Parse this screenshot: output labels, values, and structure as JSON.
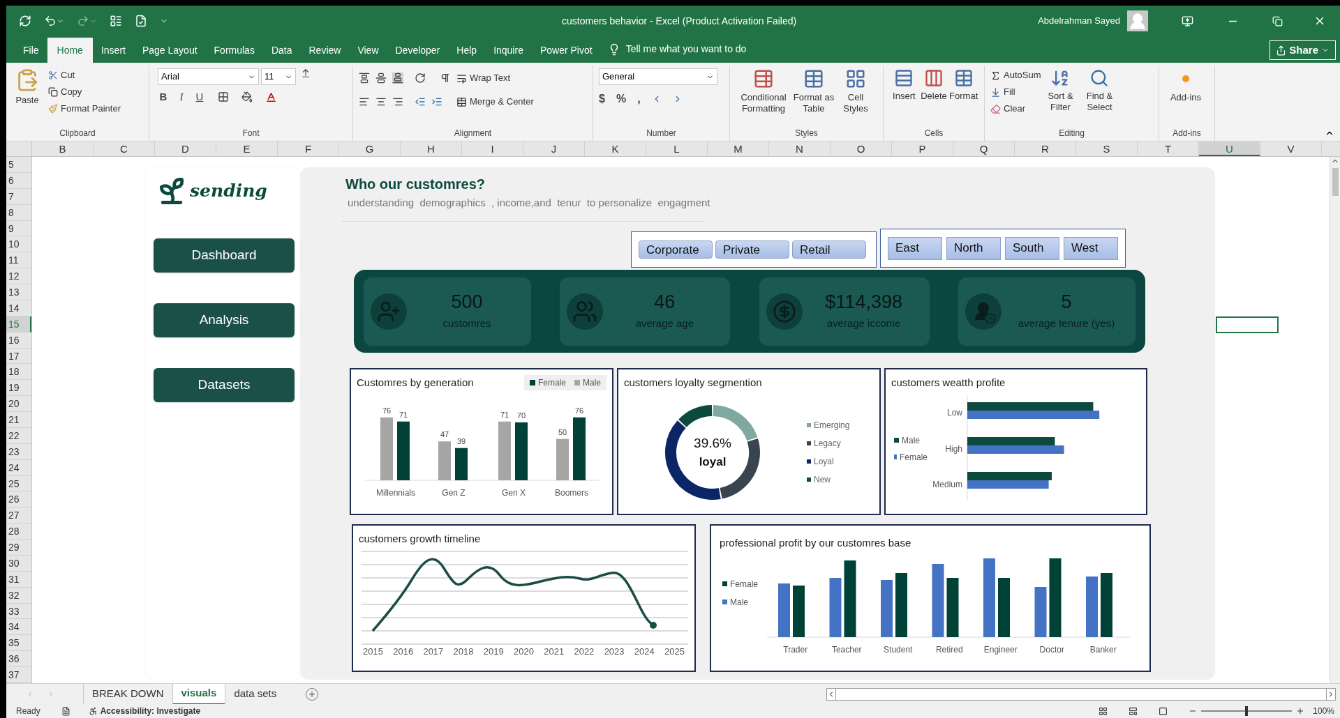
{
  "title_bar": {
    "title": "customers behavior  -  Excel (Product Activation Failed)",
    "user": "Abdelrahman Sayed"
  },
  "ribbon_tabs": [
    {
      "label": "File",
      "selected": false
    },
    {
      "label": "Home",
      "selected": true
    },
    {
      "label": "Insert",
      "selected": false
    },
    {
      "label": "Page Layout",
      "selected": false
    },
    {
      "label": "Formulas",
      "selected": false
    },
    {
      "label": "Data",
      "selected": false
    },
    {
      "label": "Review",
      "selected": false
    },
    {
      "label": "View",
      "selected": false
    },
    {
      "label": "Developer",
      "selected": false
    },
    {
      "label": "Help",
      "selected": false
    },
    {
      "label": "Inquire",
      "selected": false
    },
    {
      "label": "Power Pivot",
      "selected": false
    }
  ],
  "tell_me": "Tell me what you want to do",
  "share": "Share",
  "ribbon": {
    "clipboard": {
      "paste": "Paste",
      "cut": "Cut",
      "copy": "Copy",
      "format_painter": "Format Painter",
      "label": "Clipboard"
    },
    "font": {
      "family": "Arial",
      "size": "11",
      "styles": [
        "B",
        "I",
        "U"
      ],
      "label": "Font"
    },
    "alignment": {
      "wrap": "Wrap Text",
      "merge": "Merge & Center",
      "label": "Alignment"
    },
    "number": {
      "format": "General",
      "symbols": [
        "$",
        "%",
        ","
      ],
      "label": "Number"
    },
    "styles": {
      "items": [
        "Conditional Formatting",
        "Format as Table",
        "Cell Styles"
      ],
      "label": "Styles"
    },
    "cells": {
      "items": [
        "Insert",
        "Delete",
        "Format"
      ],
      "label": "Cells"
    },
    "editing": {
      "autosum": "AutoSum",
      "fill": "Fill",
      "clear": "Clear",
      "sort": "Sort & Filter",
      "find": "Find & Select",
      "label": "Editing"
    },
    "addins": {
      "button": "Add-ins",
      "label": "Add-ins"
    }
  },
  "columns": [
    {
      "label": "B",
      "selected": false
    },
    {
      "label": "C",
      "selected": false
    },
    {
      "label": "D",
      "selected": false
    },
    {
      "label": "E",
      "selected": false
    },
    {
      "label": "F",
      "selected": false
    },
    {
      "label": "G",
      "selected": false
    },
    {
      "label": "H",
      "selected": false
    },
    {
      "label": "I",
      "selected": false
    },
    {
      "label": "J",
      "selected": false
    },
    {
      "label": "K",
      "selected": false
    },
    {
      "label": "L",
      "selected": false
    },
    {
      "label": "M",
      "selected": false
    },
    {
      "label": "N",
      "selected": false
    },
    {
      "label": "O",
      "selected": false
    },
    {
      "label": "P",
      "selected": false
    },
    {
      "label": "Q",
      "selected": false
    },
    {
      "label": "R",
      "selected": false
    },
    {
      "label": "S",
      "selected": false
    },
    {
      "label": "T",
      "selected": false
    },
    {
      "label": "U",
      "selected": true
    },
    {
      "label": "V",
      "selected": false
    }
  ],
  "rows": [
    {
      "label": "5",
      "selected": false
    },
    {
      "label": "6",
      "selected": false
    },
    {
      "label": "7",
      "selected": false
    },
    {
      "label": "8",
      "selected": false
    },
    {
      "label": "9",
      "selected": false
    },
    {
      "label": "10",
      "selected": false
    },
    {
      "label": "11",
      "selected": false
    },
    {
      "label": "12",
      "selected": false
    },
    {
      "label": "13",
      "selected": false
    },
    {
      "label": "14",
      "selected": false
    },
    {
      "label": "15",
      "selected": true
    },
    {
      "label": "16",
      "selected": false
    },
    {
      "label": "17",
      "selected": false
    },
    {
      "label": "18",
      "selected": false
    },
    {
      "label": "19",
      "selected": false
    },
    {
      "label": "20",
      "selected": false
    },
    {
      "label": "21",
      "selected": false
    },
    {
      "label": "22",
      "selected": false
    },
    {
      "label": "23",
      "selected": false
    },
    {
      "label": "24",
      "selected": false
    },
    {
      "label": "25",
      "selected": false
    },
    {
      "label": "26",
      "selected": false
    },
    {
      "label": "27",
      "selected": false
    },
    {
      "label": "28",
      "selected": false
    },
    {
      "label": "29",
      "selected": false
    },
    {
      "label": "30",
      "selected": false
    },
    {
      "label": "31",
      "selected": false
    },
    {
      "label": "32",
      "selected": false
    },
    {
      "label": "33",
      "selected": false
    },
    {
      "label": "34",
      "selected": false
    },
    {
      "label": "35",
      "selected": false
    },
    {
      "label": "36",
      "selected": false
    },
    {
      "label": "37",
      "selected": false
    }
  ],
  "dashboard": {
    "logo": "sending",
    "nav": [
      "Dashboard",
      "Analysis",
      "Datasets"
    ],
    "title": "Who our customres?",
    "subtitle": "understanding  demographics  , income,and  tenur  to personalize  engagment",
    "segment_slicer": [
      "Corporate",
      "Private",
      "Retail"
    ],
    "region_slicer": [
      "East",
      "North",
      "South",
      "West"
    ],
    "kpis": [
      {
        "kind": "customers",
        "value": "500",
        "label": "customres"
      },
      {
        "kind": "age",
        "value": "46",
        "label": "average age"
      },
      {
        "kind": "income",
        "value": "$114,398",
        "label": "average iccome"
      },
      {
        "kind": "tenure",
        "value": "5",
        "label": "average tenure (yes)"
      }
    ],
    "generation": {
      "title": "Customres by generation",
      "chart_data": {
        "type": "bar",
        "categories": [
          "Millennials",
          "Gen Z",
          "Gen X",
          "Boomers"
        ],
        "data_labels": true,
        "series": [
          {
            "name": "Male",
            "color": "#a6a6a6",
            "values": [
              76,
              47,
              71,
              50
            ]
          },
          {
            "name": "Female",
            "color": "#004238",
            "values": [
              71,
              39,
              70,
              76
            ]
          }
        ]
      }
    },
    "loyalty": {
      "title": "customers loyalty segmention",
      "center_value": "39.6%",
      "center_label": "loyal",
      "legend": [
        {
          "name": "Emerging",
          "color": "#7fa8a0"
        },
        {
          "name": "Legacy",
          "color": "#38444f"
        },
        {
          "name": "Loyal",
          "color": "#0b2566"
        },
        {
          "name": "New",
          "color": "#0b4a3c"
        }
      ]
    },
    "wealth": {
      "title": "customers weatth profite",
      "categories": [
        "Low",
        "High",
        "Medium"
      ],
      "legend": [
        {
          "name": "Male",
          "color": "#0b4a3c"
        },
        {
          "name": "Female",
          "color": "#4472c4"
        }
      ]
    },
    "growth": {
      "title": "customers growth timeline",
      "x_labels": [
        "2015",
        "2016",
        "2017",
        "2018",
        "2019",
        "2020",
        "2021",
        "2022",
        "2023",
        "2024",
        "2025"
      ]
    },
    "profit": {
      "title": "professional profit by our customres base",
      "categories": [
        "Trader",
        "Teacher",
        "Student",
        "Retired",
        "Engineer",
        "Doctor",
        "Banker"
      ],
      "legend": [
        {
          "name": "Female",
          "color": "#004238"
        },
        {
          "name": "Male",
          "color": "#4472c4"
        }
      ]
    }
  },
  "sheet_tabs": [
    {
      "label": "BREAK DOWN",
      "selected": false
    },
    {
      "label": "visuals",
      "selected": true
    },
    {
      "label": "data sets",
      "selected": false
    }
  ],
  "status": {
    "ready": "Ready",
    "accessibility": "Accessibility: Investigate",
    "zoom": "100%",
    "zoom_slider": {
      "level": 0.5
    }
  }
}
